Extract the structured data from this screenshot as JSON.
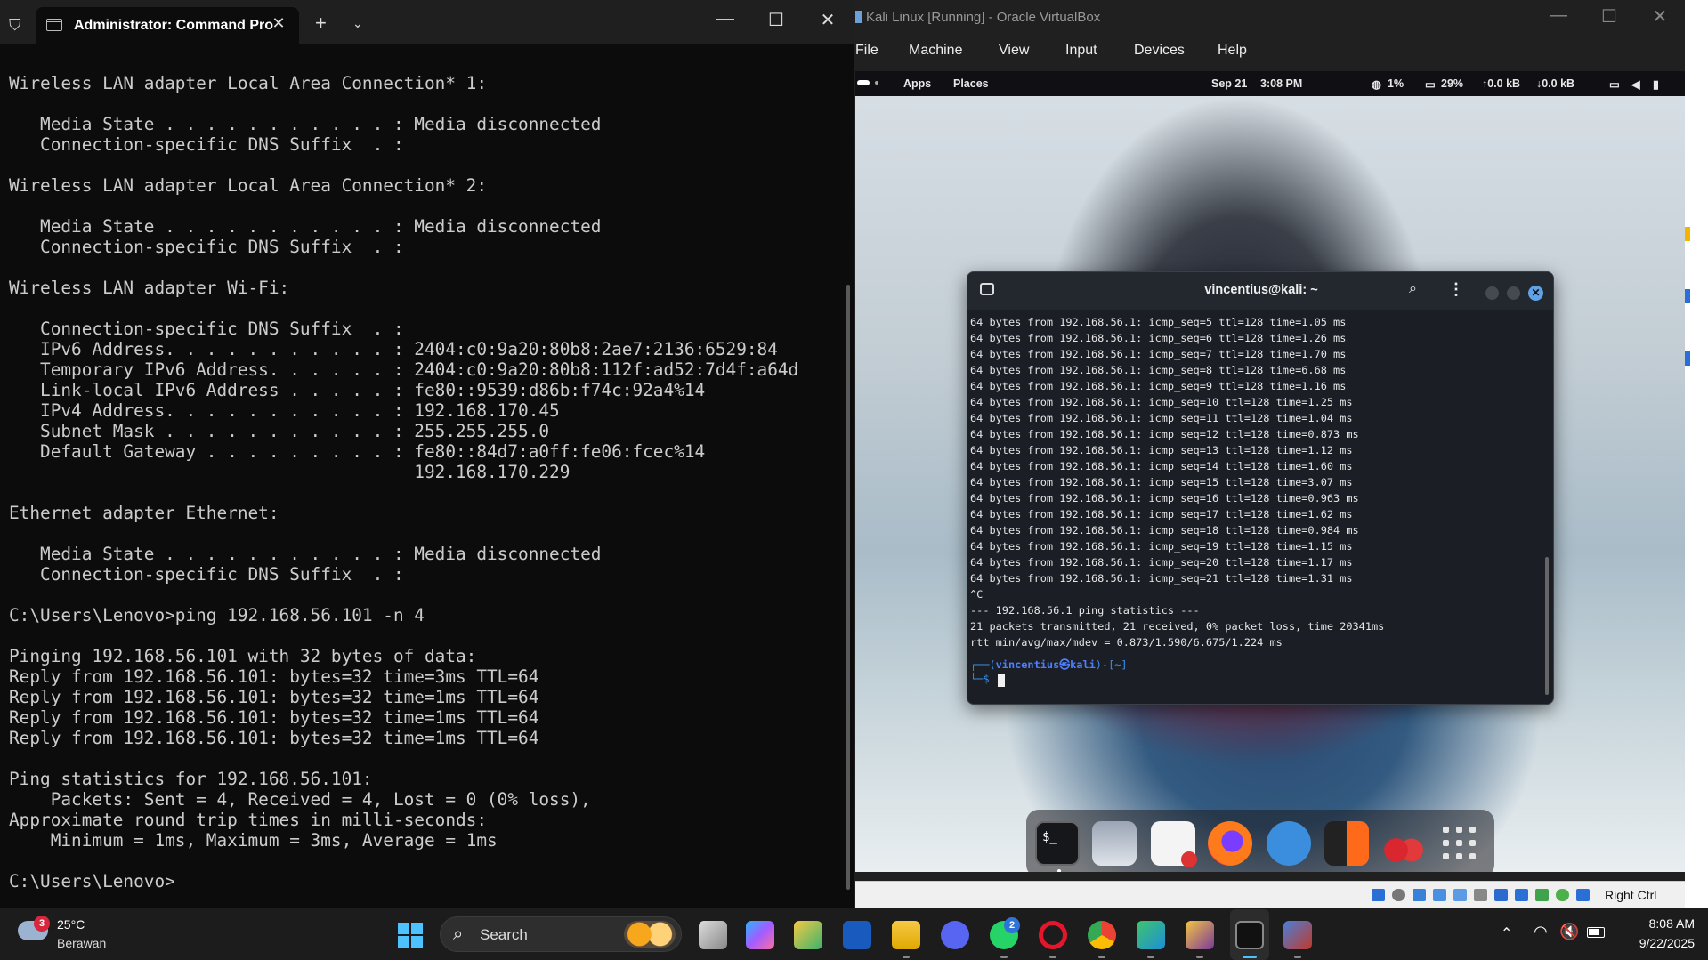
{
  "cmd": {
    "tab_title": "Administrator: Command Pro",
    "close_glyph": "✕",
    "new_tab_glyph": "+",
    "dropdown_glyph": "⌄",
    "minimize_glyph": "—",
    "maximize_glyph": "☐",
    "window_close_glyph": "✕",
    "output": "Wireless LAN adapter Local Area Connection* 1:\n\n   Media State . . . . . . . . . . . : Media disconnected\n   Connection-specific DNS Suffix  . :\n\nWireless LAN adapter Local Area Connection* 2:\n\n   Media State . . . . . . . . . . . : Media disconnected\n   Connection-specific DNS Suffix  . :\n\nWireless LAN adapter Wi-Fi:\n\n   Connection-specific DNS Suffix  . :\n   IPv6 Address. . . . . . . . . . . : 2404:c0:9a20:80b8:2ae7:2136:6529:84\n   Temporary IPv6 Address. . . . . . : 2404:c0:9a20:80b8:112f:ad52:7d4f:a64d\n   Link-local IPv6 Address . . . . . : fe80::9539:d86b:f74c:92a4%14\n   IPv4 Address. . . . . . . . . . . : 192.168.170.45\n   Subnet Mask . . . . . . . . . . . : 255.255.255.0\n   Default Gateway . . . . . . . . . : fe80::84d7:a0ff:fe06:fcec%14\n                                       192.168.170.229\n\nEthernet adapter Ethernet:\n\n   Media State . . . . . . . . . . . : Media disconnected\n   Connection-specific DNS Suffix  . :\n\nC:\\Users\\Lenovo>ping 192.168.56.101 -n 4\n\nPinging 192.168.56.101 with 32 bytes of data:\nReply from 192.168.56.101: bytes=32 time=3ms TTL=64\nReply from 192.168.56.101: bytes=32 time=1ms TTL=64\nReply from 192.168.56.101: bytes=32 time=1ms TTL=64\nReply from 192.168.56.101: bytes=32 time=1ms TTL=64\n\nPing statistics for 192.168.56.101:\n    Packets: Sent = 4, Received = 4, Lost = 0 (0% loss),\nApproximate round trip times in milli-seconds:\n    Minimum = 1ms, Maximum = 3ms, Average = 1ms\n\nC:\\Users\\Lenovo>"
  },
  "vbox": {
    "title": "Kali Linux  [Running] - Oracle VirtualBox",
    "minimize_glyph": "—",
    "maximize_glyph": "☐",
    "close_glyph": "✕",
    "menu": {
      "file": "File",
      "machine": "Machine",
      "view": "View",
      "input": "Input",
      "devices": "Devices",
      "help": "Help"
    },
    "host_key_label": "Right Ctrl"
  },
  "kali": {
    "panel": {
      "apps": "Apps",
      "places": "Places",
      "date": "Sep 21",
      "time": "3:08 PM",
      "cpu_icon": "◍",
      "cpu": "1%",
      "mem_icon": "▭",
      "mem": "29%",
      "net_up": "↑0.0 kB",
      "net_down": "↓0.0 kB",
      "screen_icon": "▭",
      "volume_icon": "◀",
      "battery_icon": "▮"
    },
    "terminal": {
      "title": "vincentius@kali: ~",
      "search_icon": "⌕",
      "menu_icon": "⋮",
      "close_glyph": "✕",
      "output": "64 bytes from 192.168.56.1: icmp_seq=5 ttl=128 time=1.05 ms\n64 bytes from 192.168.56.1: icmp_seq=6 ttl=128 time=1.26 ms\n64 bytes from 192.168.56.1: icmp_seq=7 ttl=128 time=1.70 ms\n64 bytes from 192.168.56.1: icmp_seq=8 ttl=128 time=6.68 ms\n64 bytes from 192.168.56.1: icmp_seq=9 ttl=128 time=1.16 ms\n64 bytes from 192.168.56.1: icmp_seq=10 ttl=128 time=1.25 ms\n64 bytes from 192.168.56.1: icmp_seq=11 ttl=128 time=1.04 ms\n64 bytes from 192.168.56.1: icmp_seq=12 ttl=128 time=0.873 ms\n64 bytes from 192.168.56.1: icmp_seq=13 ttl=128 time=1.12 ms\n64 bytes from 192.168.56.1: icmp_seq=14 ttl=128 time=1.60 ms\n64 bytes from 192.168.56.1: icmp_seq=15 ttl=128 time=3.07 ms\n64 bytes from 192.168.56.1: icmp_seq=16 ttl=128 time=0.963 ms\n64 bytes from 192.168.56.1: icmp_seq=17 ttl=128 time=1.62 ms\n64 bytes from 192.168.56.1: icmp_seq=18 ttl=128 time=0.984 ms\n64 bytes from 192.168.56.1: icmp_seq=19 ttl=128 time=1.15 ms\n64 bytes from 192.168.56.1: icmp_seq=20 ttl=128 time=1.17 ms\n64 bytes from 192.168.56.1: icmp_seq=21 ttl=128 time=1.31 ms\n^C\n--- 192.168.56.1 ping statistics ---\n21 packets transmitted, 21 received, 0% packet loss, time 20341ms\nrtt min/avg/max/mdev = 0.873/1.590/6.675/1.224 ms",
      "prompt_open": "┌──(",
      "prompt_user": "vincentius㉿kali",
      "prompt_close": ")-[~]",
      "prompt_line2": "└─$ "
    },
    "dock": {
      "terminal_glyph": "$_",
      "items": [
        "terminal-icon",
        "files-icon",
        "text-editor-icon",
        "firefox-icon",
        "wireshark-icon",
        "burpsuite-icon",
        "cherrytree-icon",
        "app-grid-icon"
      ]
    }
  },
  "taskbar": {
    "weather_badge": "3",
    "temperature": "25°C",
    "condition": "Berawan",
    "search_icon": "⌕",
    "search_placeholder": "Search",
    "whatsapp_badge": "2",
    "tray_up": "⌃",
    "wifi_icon": "◠",
    "volume_icon": "🔇",
    "time": "8:08 AM",
    "date": "9/22/2025",
    "apps": [
      "task-view-icon",
      "copilot-icon",
      "notes-icon",
      "word-icon",
      "file-explorer-icon",
      "discord-icon",
      "whatsapp-icon",
      "opera-icon",
      "chrome-icon",
      "vscode-icon",
      "winrar-icon",
      "terminal-icon",
      "virtualbox-icon"
    ]
  },
  "colors": {
    "cmd_bg": "#0c0c0c",
    "cmd_text": "#cccccc",
    "kali_prompt": "#3b8eea",
    "start_blue": "#4cc2ff"
  }
}
